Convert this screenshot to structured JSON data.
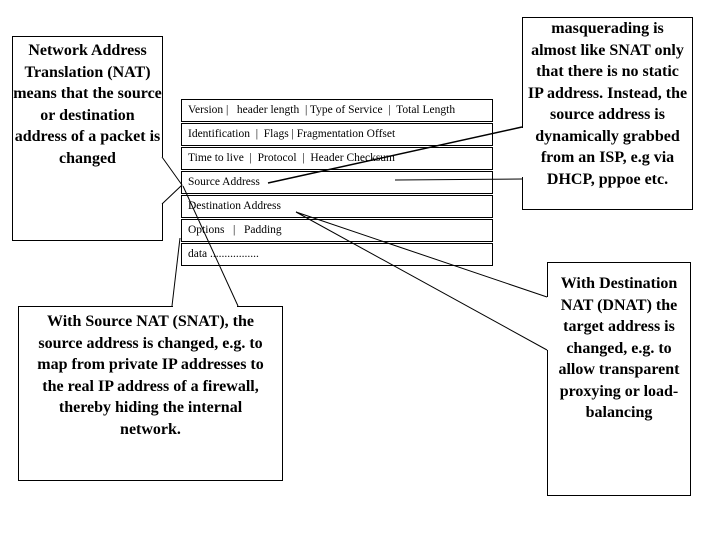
{
  "header_rows": [
    "Version |   header length  | Type of Service  |  Total Length",
    "Identification  |  Flags | Fragmentation Offset",
    "Time to live  |  Protocol  |  Header Checksum",
    "Source Address",
    "Destination Address",
    "Options   |   Padding",
    "data ................."
  ],
  "callouts": {
    "nat": "Network Address Translation (NAT) means that the source or destination address of a packet is changed",
    "snat": "With Source NAT (SNAT), the source address is changed, e.g. to map from private IP addresses to the real IP address of a firewall, thereby hiding the internal network.",
    "masquerading": "masquerading is almost like SNAT only that there is no static IP address. Instead, the source address is dynamically grabbed from an ISP, e.g via DHCP, pppoe etc.",
    "dnat": "With Destination NAT (DNAT) the target address is changed, e.g. to allow transparent proxying or load-balancing"
  }
}
